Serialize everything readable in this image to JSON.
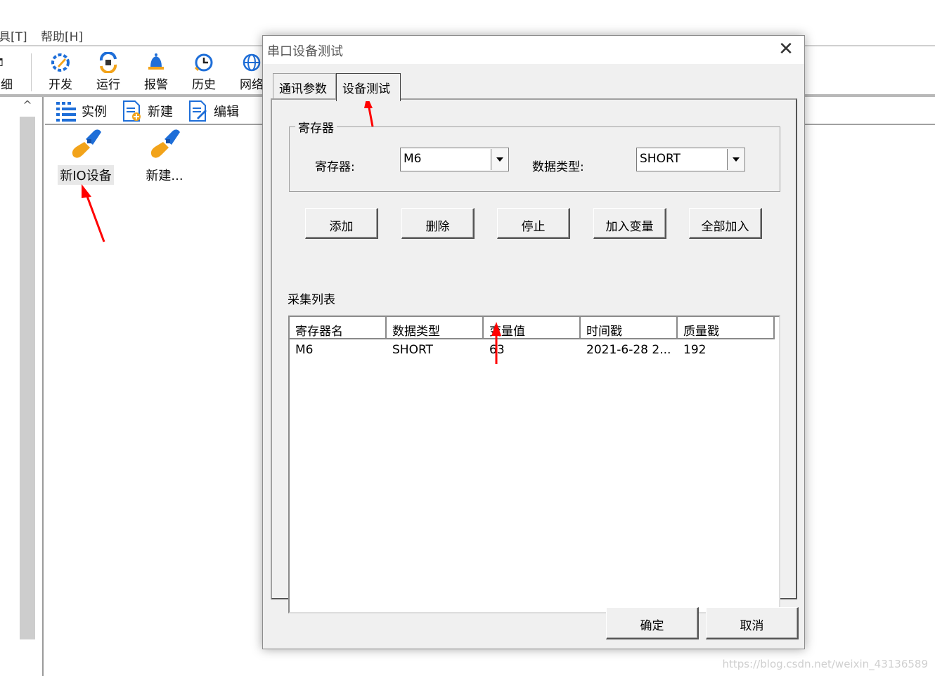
{
  "app": {
    "menu": [
      {
        "label": "具[T]"
      },
      {
        "label": "帮助[H]"
      }
    ],
    "toolbar_partial_label": "细",
    "toolbar": [
      {
        "label": "开发",
        "icon": "gear-pencil-icon"
      },
      {
        "label": "运行",
        "icon": "run-icon"
      },
      {
        "label": "报警",
        "icon": "bell-icon"
      },
      {
        "label": "历史",
        "icon": "clock-icon"
      },
      {
        "label": "网络",
        "icon": "globe-icon"
      }
    ],
    "subtoolbar": [
      {
        "label": "实例",
        "icon": "grid-icon"
      },
      {
        "label": "新建",
        "icon": "new-doc-icon"
      },
      {
        "label": "编辑",
        "icon": "edit-doc-icon"
      }
    ],
    "devices": [
      {
        "label": "新IO设备"
      },
      {
        "label": "新建..."
      }
    ],
    "scroll_up_glyph": "^"
  },
  "dialog": {
    "title": "串口设备测试",
    "close_glyph": "✕",
    "tabs": [
      {
        "label": "通讯参数",
        "active": false
      },
      {
        "label": "设备测试",
        "active": true
      }
    ],
    "register_group": {
      "title": "寄存器",
      "register_label": "寄存器:",
      "register_value": "M6",
      "datatype_label": "数据类型:",
      "datatype_value": "SHORT"
    },
    "buttons": {
      "add": "添加",
      "delete": "删除",
      "stop": "停止",
      "add_var": "加入变量",
      "add_all": "全部加入"
    },
    "list_title": "采集列表",
    "columns": [
      "寄存器名",
      "数据类型",
      "变量值",
      "时间戳",
      "质量戳"
    ],
    "rows": [
      {
        "name": "M6",
        "type": "SHORT",
        "value": "63",
        "time": "2021-6-28 2...",
        "quality": "192"
      }
    ],
    "ok": "确定",
    "cancel": "取消"
  },
  "watermark": "https://blog.csdn.net/weixin_43136589",
  "colors": {
    "accent_arrow": "#ff0000",
    "dialog_bg": "#f0f0f0"
  }
}
